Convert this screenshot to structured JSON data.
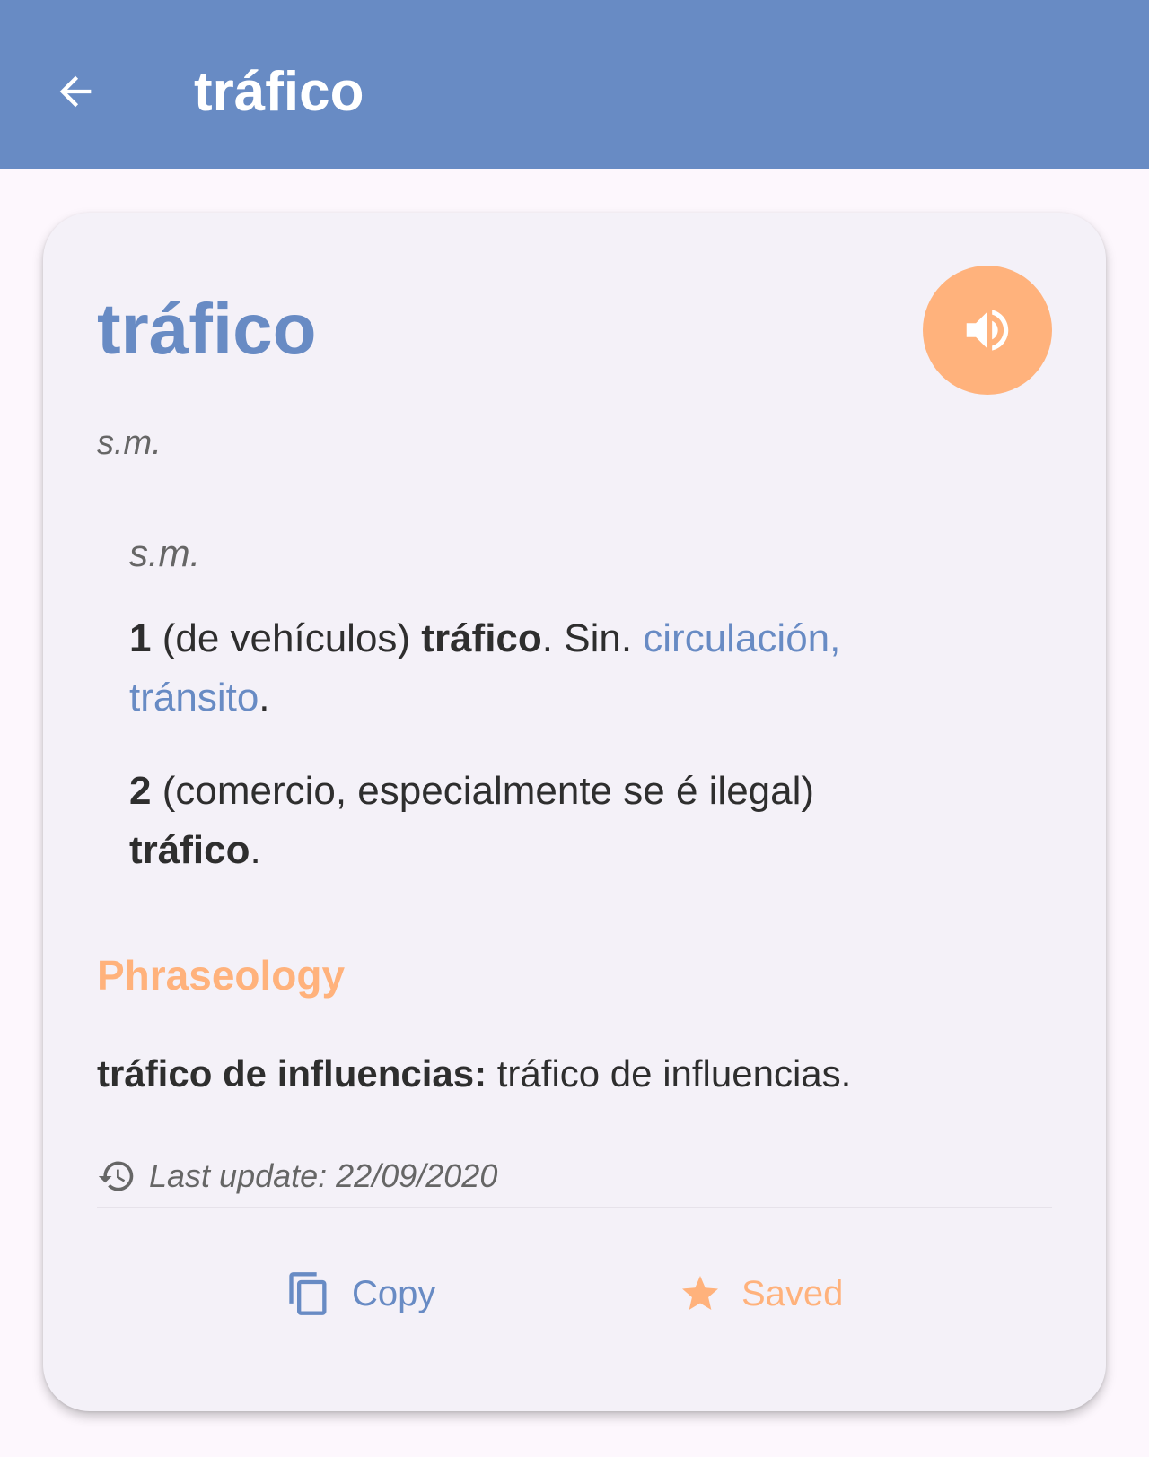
{
  "appbar": {
    "title": "tráfico",
    "back_icon": "arrow-back-icon"
  },
  "entry": {
    "headword": "tráfico",
    "pos": "s.m.",
    "audio_icon": "speaker-icon",
    "sub_pos": "s.m.",
    "senses": [
      {
        "num": "1",
        "text1": " (de vehículos) ",
        "bold": "tráfico",
        "text2": ". Sin. ",
        "link1": "circulación,",
        "link2": "tránsito",
        "end": "."
      },
      {
        "num": "2",
        "text1": " (comercio, especialmente se é ilegal) ",
        "bold": "tráfico",
        "end": "."
      }
    ],
    "phraseology": {
      "heading": "Phraseology",
      "items": [
        {
          "term": "tráfico de influencias:",
          "def": " tráfico de influencias."
        }
      ]
    },
    "last_update": "Last update: 22/09/2020"
  },
  "actions": {
    "copy_label": "Copy",
    "saved_label": "Saved"
  },
  "colors": {
    "primary": "#688bc4",
    "accent": "#ffb27c",
    "background": "#fdf7fd",
    "card": "#f4f1f8"
  }
}
